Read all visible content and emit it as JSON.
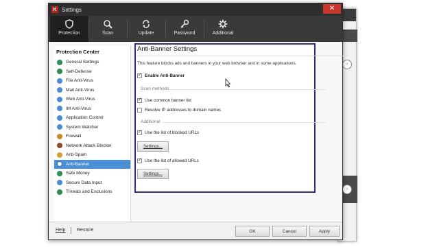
{
  "window": {
    "title": "Settings"
  },
  "toolbar": {
    "items": [
      {
        "label": "Protection",
        "icon": "shield-icon"
      },
      {
        "label": "Scan",
        "icon": "magnifier-icon"
      },
      {
        "label": "Update",
        "icon": "refresh-icon"
      },
      {
        "label": "Password",
        "icon": "key-icon"
      },
      {
        "label": "Additional",
        "icon": "gear-icon"
      }
    ]
  },
  "sidebar": {
    "title": "Protection Center",
    "items": [
      {
        "label": "General Settings",
        "color": "#2e8b57"
      },
      {
        "label": "Self-Defense",
        "color": "#2e8b57"
      },
      {
        "label": "File Anti-Virus",
        "color": "#4b8bd6"
      },
      {
        "label": "Mail Anti-Virus",
        "color": "#4b8bd6"
      },
      {
        "label": "Web Anti-Virus",
        "color": "#4b8bd6"
      },
      {
        "label": "IM Anti-Virus",
        "color": "#4b8bd6"
      },
      {
        "label": "Application Control",
        "color": "#4b8bd6"
      },
      {
        "label": "System Watcher",
        "color": "#4b8bd6"
      },
      {
        "label": "Firewall",
        "color": "#c98b2a"
      },
      {
        "label": "Network Attack Blocker",
        "color": "#8c4c2e"
      },
      {
        "label": "Anti-Spam",
        "color": "#d0a030"
      },
      {
        "label": "Anti-Banner",
        "color": "#ffffff"
      },
      {
        "label": "Safe Money",
        "color": "#2e8b57"
      },
      {
        "label": "Secure Data Input",
        "color": "#4b8bd6"
      },
      {
        "label": "Threats and Exclusions",
        "color": "#2e8b57"
      }
    ],
    "selected_index": 11
  },
  "content": {
    "title": "Anti-Banner Settings",
    "description": "This feature blocks ads and banners in your web browser and in some applications.",
    "enable_label": "Enable Anti-Banner",
    "enable_checked": true,
    "scan_methods_label": "Scan methods",
    "use_common_label": "Use common banner list",
    "use_common_checked": true,
    "resolve_ip_label": "Resolve IP addresses to domain names",
    "resolve_ip_checked": false,
    "additional_label": "Additional",
    "blocked_label": "Use the list of blocked URLs",
    "blocked_checked": true,
    "blocked_settings_label": "Settings...",
    "allowed_label": "Use the list of allowed URLs",
    "allowed_checked": true,
    "allowed_settings_label": "Settings..."
  },
  "footer": {
    "help_label": "Help",
    "restore_label": "Restore",
    "ok_label": "OK",
    "cancel_label": "Cancel",
    "apply_label": "Apply"
  }
}
